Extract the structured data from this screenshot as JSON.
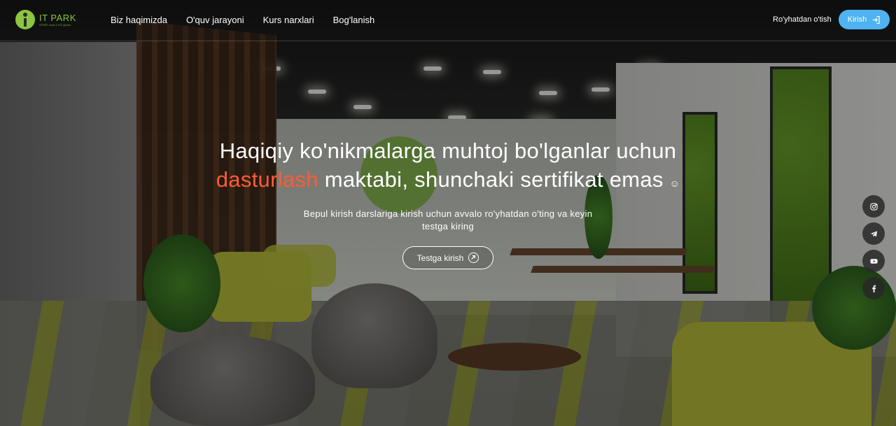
{
  "brand": {
    "name": "IT PARK",
    "tagline": "START local & GO global",
    "color": "#8cc63f"
  },
  "nav": {
    "items": [
      {
        "label": "Biz haqimizda"
      },
      {
        "label": "O'quv jarayoni"
      },
      {
        "label": "Kurs narxlari"
      },
      {
        "label": "Bog'lanish"
      }
    ],
    "register_label": "Ro'yhatdan o'tish",
    "login_label": "Kirish",
    "login_icon": "sign-in-icon",
    "login_color": "#4eb3f0"
  },
  "hero": {
    "headline_before": "Haqiqiy ko'nikmalarga muhtoj bo'lganlar uchun",
    "headline_accent": "dasturlash",
    "headline_after": "maktabi, shunchaki sertifikat emas",
    "headline_emoji": "☺",
    "accent_color": "#ff5b35",
    "subtitle": "Bepul kirish darslariga kirish uchun avvalo ro'yhatdan o'ting va keyin testga kiring",
    "cta_label": "Testga kirish",
    "cta_icon": "arrow-up-right-circle-icon"
  },
  "social": {
    "items": [
      {
        "icon": "instagram-icon"
      },
      {
        "icon": "telegram-icon"
      },
      {
        "icon": "youtube-icon"
      },
      {
        "icon": "facebook-icon"
      }
    ]
  }
}
